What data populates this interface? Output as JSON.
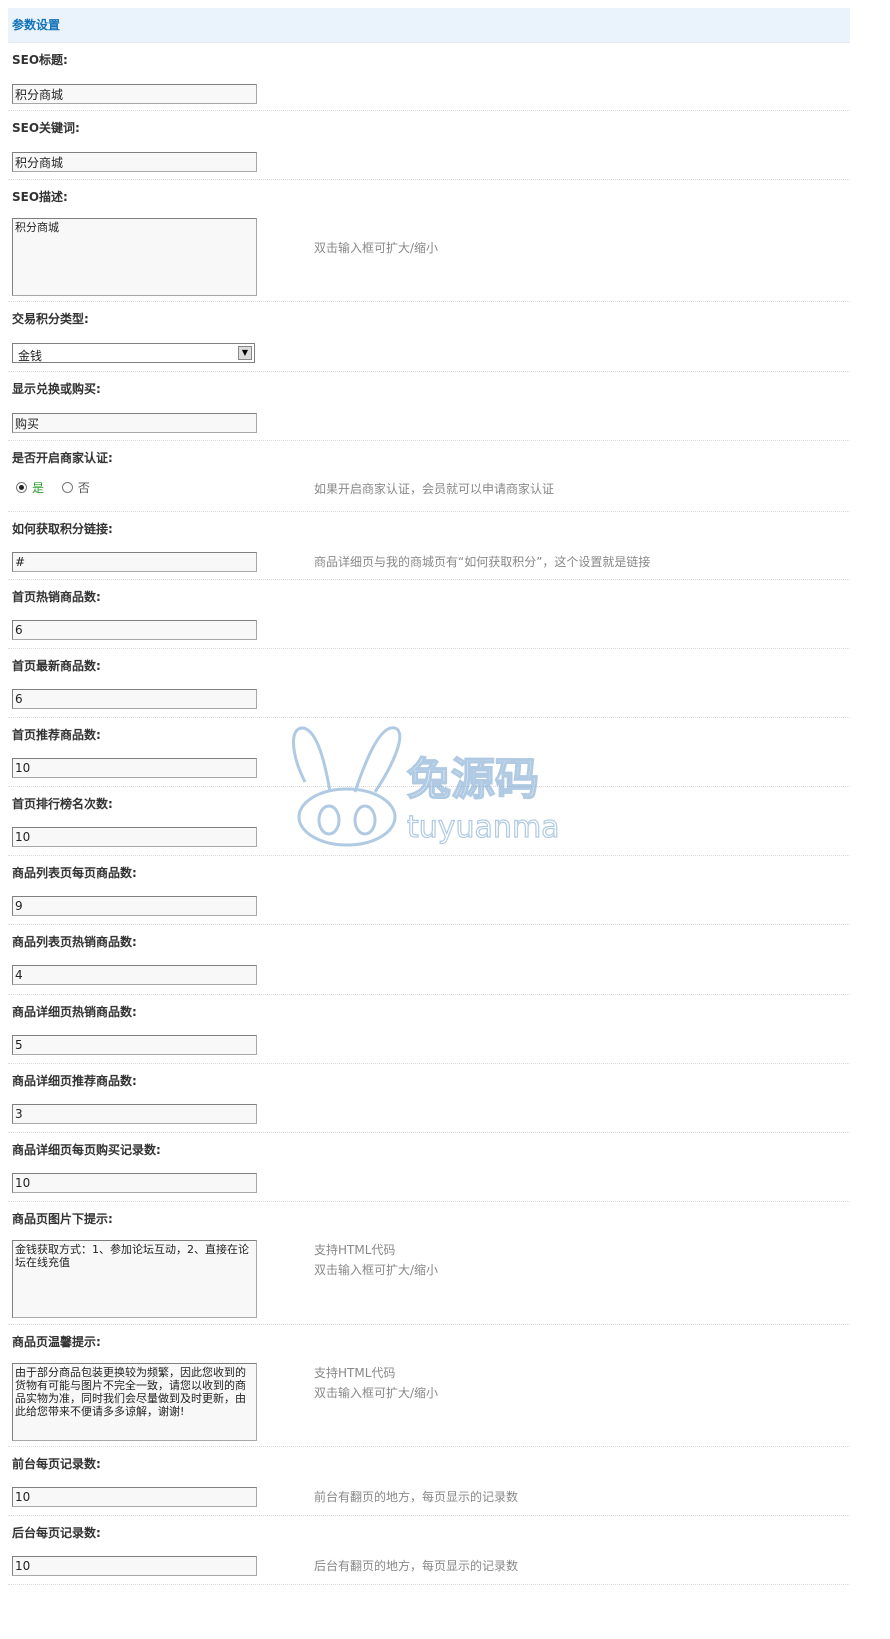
{
  "section_title": "参数设置",
  "seo_title": {
    "label": "SEO标题:",
    "value": "积分商城"
  },
  "seo_keywords": {
    "label": "SEO关键词:",
    "value": "积分商城"
  },
  "seo_description": {
    "label": "SEO描述:",
    "value": "积分商城",
    "hint": "双击输入框可扩大/缩小"
  },
  "trade_credit_type": {
    "label": "交易积分类型:",
    "value": "金钱"
  },
  "exchange_or_buy": {
    "label": "显示兑换或购买:",
    "value": "购买"
  },
  "merchant_auth": {
    "label": "是否开启商家认证:",
    "yes": "是",
    "no": "否",
    "hint": "如果开启商家认证，会员就可以申请商家认证"
  },
  "credit_link": {
    "label": "如何获取积分链接:",
    "value": "#",
    "hint": "商品详细页与我的商城页有“如何获取积分”，这个设置就是链接"
  },
  "home_hot": {
    "label": "首页热销商品数:",
    "value": "6"
  },
  "home_new": {
    "label": "首页最新商品数:",
    "value": "6"
  },
  "home_recommend": {
    "label": "首页推荐商品数:",
    "value": "10"
  },
  "home_rank": {
    "label": "首页排行榜名次数:",
    "value": "10"
  },
  "list_per_page": {
    "label": "商品列表页每页商品数:",
    "value": "9"
  },
  "list_hot": {
    "label": "商品列表页热销商品数:",
    "value": "4"
  },
  "detail_hot": {
    "label": "商品详细页热销商品数:",
    "value": "5"
  },
  "detail_recommend": {
    "label": "商品详细页推荐商品数:",
    "value": "3"
  },
  "detail_buy_records": {
    "label": "商品详细页每页购买记录数:",
    "value": "10"
  },
  "image_tip": {
    "label": "商品页图片下提示:",
    "value": "金钱获取方式：1、参加论坛互动，2、直接在论坛在线充值",
    "hint1": "支持HTML代码",
    "hint2": "双击输入框可扩大/缩小"
  },
  "warm_tip": {
    "label": "商品页温馨提示:",
    "value": "由于部分商品包装更换较为频繁，因此您收到的货物有可能与图片不完全一致，请您以收到的商品实物为准，同时我们会尽量做到及时更新，由此给您带来不便请多多谅解，谢谢!",
    "hint1": "支持HTML代码",
    "hint2": "双击输入框可扩大/缩小"
  },
  "front_per_page": {
    "label": "前台每页记录数:",
    "value": "10",
    "hint": "前台有翻页的地方，每页显示的记录数"
  },
  "back_per_page": {
    "label": "后台每页记录数:",
    "value": "10",
    "hint": "后台有翻页的地方，每页显示的记录数"
  },
  "watermark": {
    "cn": "兔源码",
    "en": "tuyuanma"
  }
}
